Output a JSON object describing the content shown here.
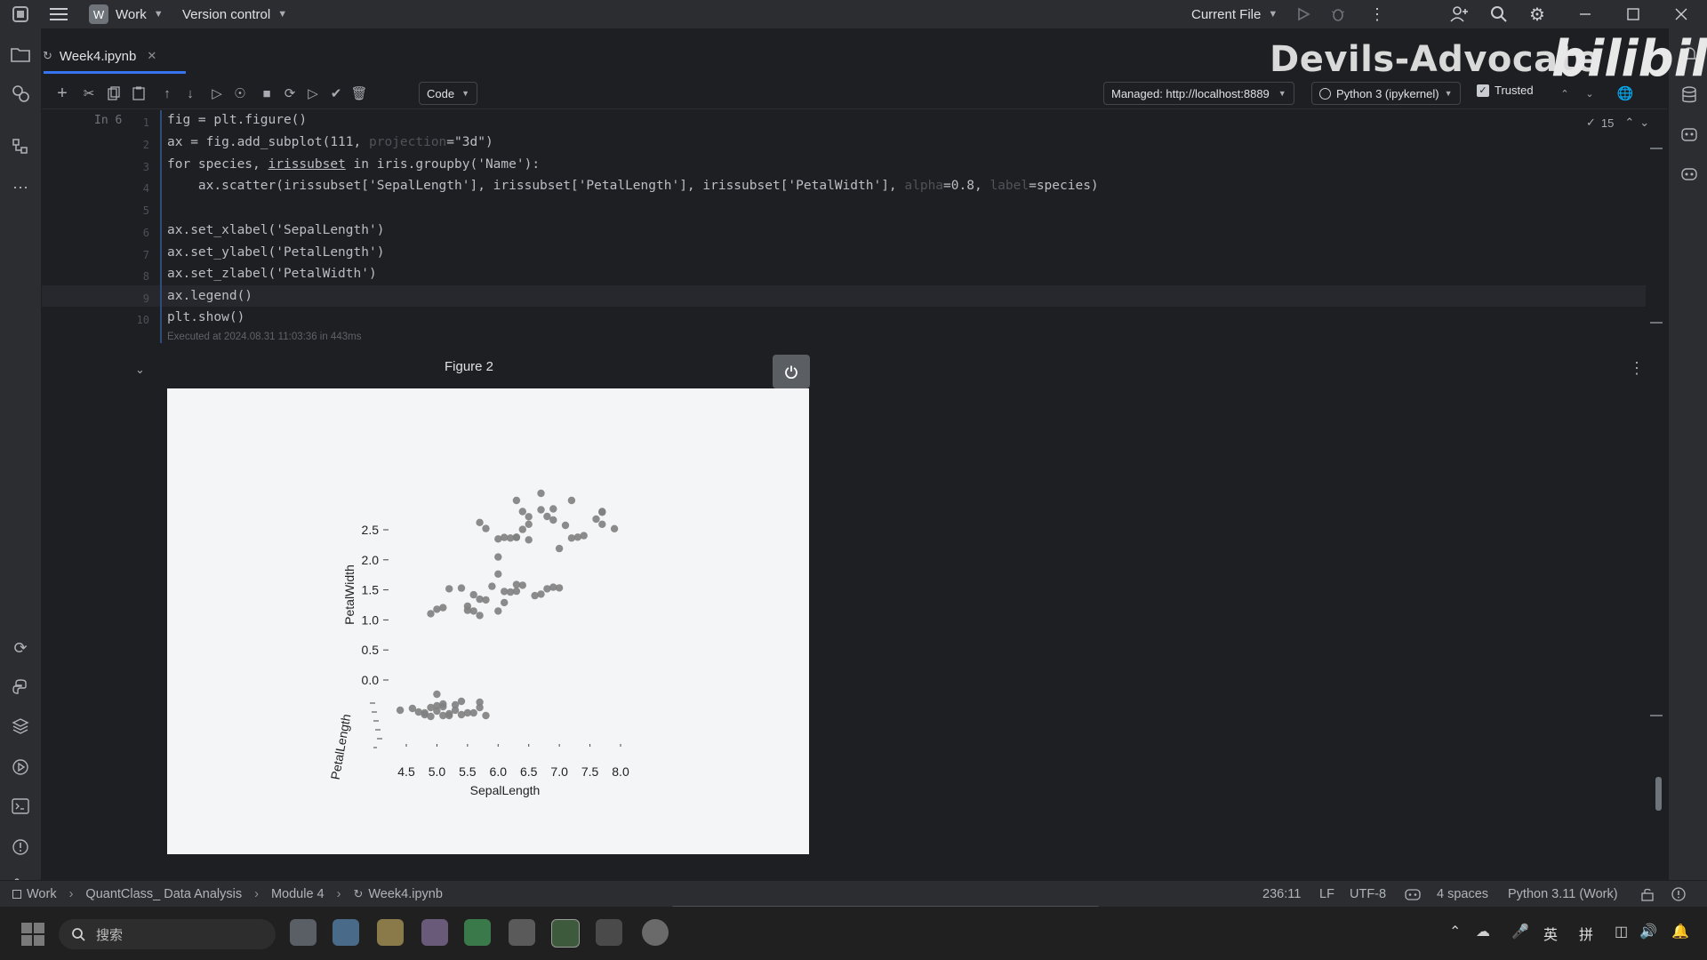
{
  "titlebar": {
    "project_badge": "W",
    "project": "Work",
    "vcs": "Version control",
    "run_config": "Current File"
  },
  "tab": {
    "filename": "Week4.ipynb"
  },
  "toolbar": {
    "cell_type": "Code",
    "server": "Managed: http://localhost:8889",
    "kernel": "Python 3 (ipykernel)",
    "trusted": "Trusted",
    "inspections_count": "15"
  },
  "cell": {
    "prompt": "In 6",
    "line_numbers": [
      "1",
      "2",
      "3",
      "4",
      "5",
      "6",
      "7",
      "8",
      "9",
      "10"
    ],
    "lines": {
      "l1": "fig = plt.figure()",
      "l2a": "ax = fig.add_subplot(111, ",
      "l2b": "projection",
      "l2c": "=\"3d\")",
      "l3a": "for species, ",
      "l3b": "irissubset",
      "l3c": " in iris.groupby(",
      "l3d": "'Name'",
      "l3e": "):",
      "l4a": "    ax.scatter(irissubset[",
      "l4b": "'SepalLength'",
      "l4c": "], irissubset[",
      "l4d": "'PetalLength'",
      "l4e": "], irissubset[",
      "l4f": "'PetalWidth'",
      "l4g": "], ",
      "l4h": "alpha",
      "l4i": "=0.8, ",
      "l4j": "label",
      "l4k": "=species)",
      "l6a": "ax.set_xlabel(",
      "l6b": "'SepalLength'",
      "l6c": ")",
      "l7a": "ax.set_ylabel(",
      "l7b": "'PetalLength'",
      "l7c": ")",
      "l8a": "ax.set_zlabel(",
      "l8b": "'PetalWidth'",
      "l8c": ")",
      "l9": "ax.legend()",
      "l10": "plt.show()"
    },
    "exec_info": "Executed at 2024.08.31 11:03:36 in 443ms"
  },
  "output": {
    "figure_title": "Figure 2"
  },
  "chart_data": {
    "type": "scatter",
    "projection": "3d",
    "title": "",
    "xlabel": "SepalLength",
    "ylabel": "PetalLength",
    "zlabel": "PetalWidth",
    "x_ticks": [
      "4.5",
      "5.0",
      "5.5",
      "6.0",
      "6.5",
      "7.0",
      "7.5",
      "8.0"
    ],
    "z_ticks": [
      "0.0",
      "0.5",
      "1.0",
      "1.5",
      "2.0",
      "2.5"
    ],
    "z_range": [
      0.0,
      2.5
    ],
    "x_range": [
      4.5,
      8.0
    ],
    "point_color": "#7f8080",
    "series": [
      {
        "points": [
          [
            4.6,
            0.2
          ],
          [
            4.8,
            0.2
          ],
          [
            4.9,
            0.1
          ],
          [
            5.0,
            0.2
          ],
          [
            5.0,
            0.3
          ],
          [
            5.1,
            0.2
          ],
          [
            5.1,
            0.4
          ],
          [
            5.2,
            0.1
          ],
          [
            5.3,
            0.2
          ],
          [
            5.4,
            0.4
          ],
          [
            5.4,
            0.2
          ],
          [
            5.5,
            0.2
          ],
          [
            5.7,
            0.3
          ],
          [
            5.7,
            0.4
          ],
          [
            5.8,
            0.2
          ],
          [
            5.2,
            0.2
          ],
          [
            4.7,
            0.2
          ],
          [
            4.4,
            0.2
          ],
          [
            5.0,
            0.6
          ],
          [
            5.1,
            0.5
          ],
          [
            5.6,
            0.2
          ],
          [
            4.9,
            0.3
          ],
          [
            4.8,
            0.1
          ],
          [
            5.3,
            0.5
          ]
        ]
      },
      {
        "points": [
          [
            5.0,
            1.0
          ],
          [
            5.1,
            1.1
          ],
          [
            5.5,
            1.2
          ],
          [
            5.6,
            1.3
          ],
          [
            5.7,
            1.3
          ],
          [
            5.8,
            1.2
          ],
          [
            5.9,
            1.5
          ],
          [
            6.0,
            1.0
          ],
          [
            6.1,
            1.4
          ],
          [
            6.2,
            1.3
          ],
          [
            6.3,
            1.5
          ],
          [
            6.4,
            1.4
          ],
          [
            6.6,
            1.3
          ],
          [
            6.7,
            1.4
          ],
          [
            6.8,
            1.4
          ],
          [
            6.9,
            1.5
          ],
          [
            7.0,
            1.4
          ],
          [
            5.5,
            1.1
          ],
          [
            5.6,
            1.0
          ],
          [
            5.7,
            1.0
          ],
          [
            6.0,
            1.6
          ],
          [
            6.1,
            1.2
          ],
          [
            6.3,
            1.3
          ],
          [
            4.9,
            1.0
          ],
          [
            5.4,
            1.5
          ],
          [
            5.2,
            1.4
          ]
        ]
      },
      {
        "points": [
          [
            5.8,
            1.9
          ],
          [
            6.0,
            1.8
          ],
          [
            6.1,
            1.9
          ],
          [
            6.2,
            1.8
          ],
          [
            6.3,
            2.5
          ],
          [
            6.3,
            1.8
          ],
          [
            6.4,
            2.3
          ],
          [
            6.5,
            2.0
          ],
          [
            6.5,
            2.2
          ],
          [
            6.7,
            2.5
          ],
          [
            6.7,
            2.3
          ],
          [
            6.8,
            2.1
          ],
          [
            6.9,
            2.3
          ],
          [
            7.1,
            2.1
          ],
          [
            7.2,
            1.8
          ],
          [
            7.2,
            2.5
          ],
          [
            7.6,
            2.1
          ],
          [
            7.7,
            2.3
          ],
          [
            7.7,
            2.0
          ],
          [
            7.9,
            2.0
          ],
          [
            6.4,
            1.9
          ],
          [
            6.5,
            1.8
          ],
          [
            5.7,
            2.0
          ],
          [
            6.0,
            1.5
          ],
          [
            6.3,
            1.9
          ],
          [
            6.9,
            2.1
          ],
          [
            7.0,
            1.7
          ],
          [
            7.3,
            1.8
          ],
          [
            7.4,
            1.9
          ],
          [
            7.7,
            2.2
          ]
        ]
      }
    ]
  },
  "breadcrumb": {
    "items": [
      "Work",
      "QuantClass_ Data Analysis",
      "Module 4",
      "Week4.ipynb"
    ]
  },
  "status": {
    "position": "236:11",
    "line_sep": "LF",
    "encoding": "UTF-8",
    "indent": "4 spaces",
    "interpreter": "Python 3.11 (Work)"
  },
  "taskbar": {
    "search_placeholder": "搜索",
    "ime_lang": "英",
    "ime_mode": "拼"
  },
  "watermark": {
    "text": "Devils-Advocate",
    "logo": "bilibili"
  }
}
